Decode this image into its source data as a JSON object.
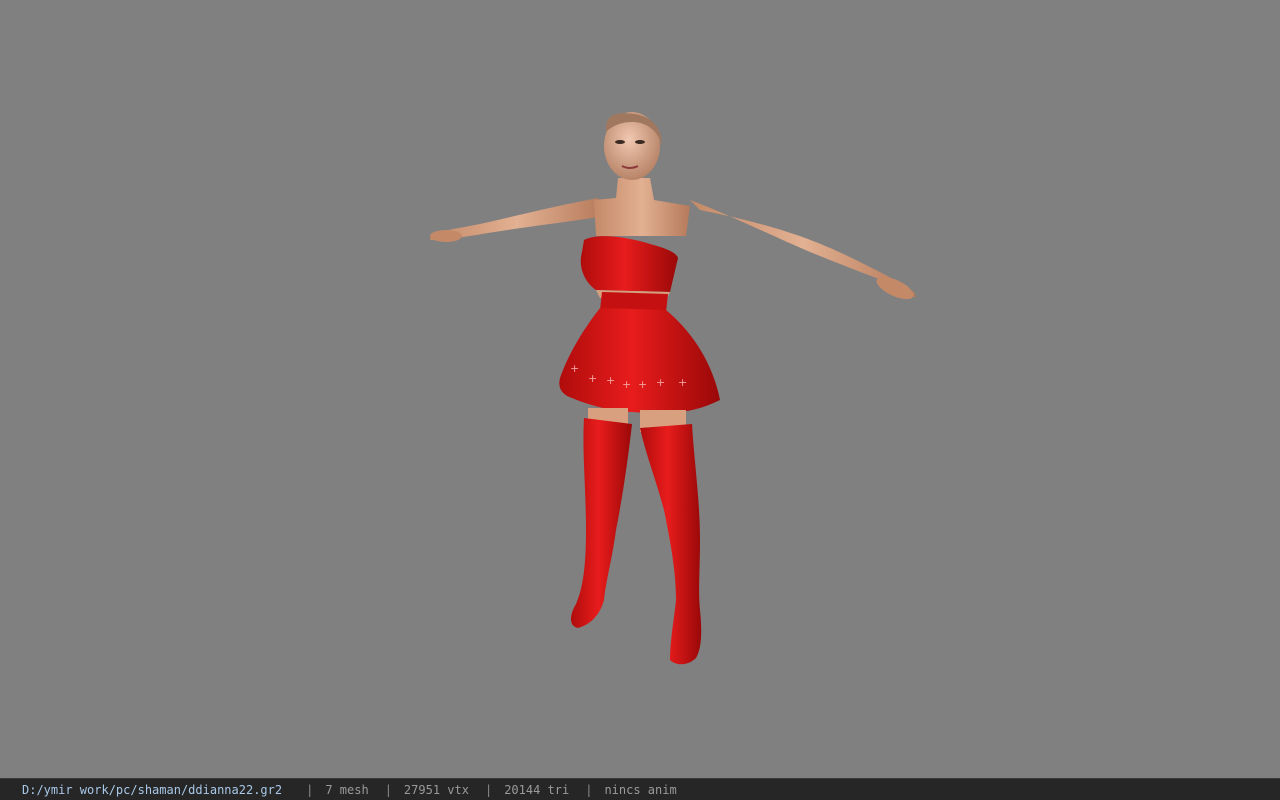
{
  "viewer": {
    "background_color": "#808080"
  },
  "model": {
    "icon": "character-model",
    "outfit_color": "#d01414",
    "skin_color": "#d8a07e"
  },
  "status": {
    "file_path": "D:/ymir work/pc/shaman/ddianna22.gr2",
    "separator": "|",
    "mesh": "7 mesh",
    "vertices": "27951 vtx",
    "triangles": "20144 tri",
    "anim": "nincs anim"
  }
}
